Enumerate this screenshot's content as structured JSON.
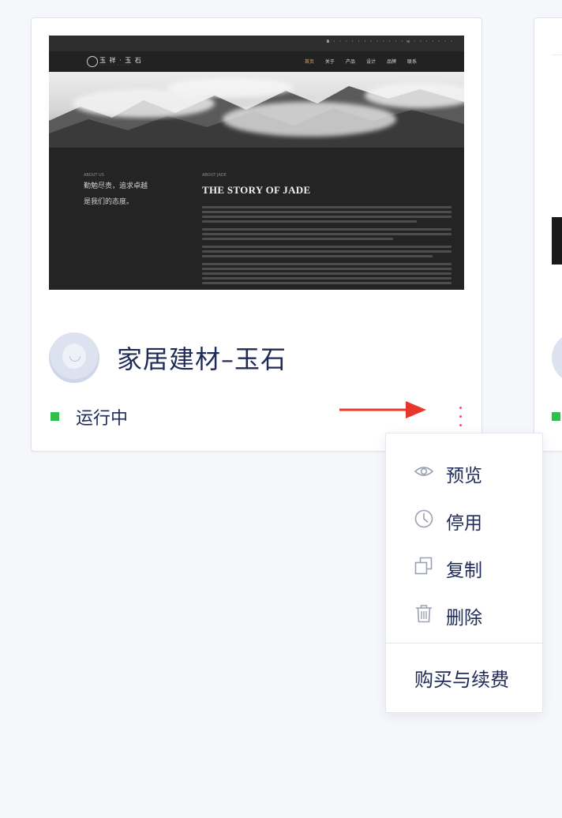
{
  "card": {
    "title": "家居建材–玉石",
    "status": "运行中",
    "status_color": "#2fbf4d",
    "more_color": "#ef4b6b"
  },
  "thumbnail": {
    "logo_text": "玉 祥 · 玉 石",
    "nav_links": [
      "首页",
      "关于",
      "产品",
      "设计",
      "品牌",
      "联系"
    ],
    "intro_label": "ABOUT US",
    "slogan_line1": "勤勉尽责，追求卓越",
    "slogan_line2": "是我们的态度。",
    "story_label": "ABOUT JADE",
    "story_title": "THE STORY OF JADE"
  },
  "menu": {
    "items": [
      {
        "label": "预览",
        "icon": "eye-icon"
      },
      {
        "label": "停用",
        "icon": "clock-icon"
      },
      {
        "label": "复制",
        "icon": "copy-icon"
      },
      {
        "label": "删除",
        "icon": "trash-icon"
      }
    ],
    "buy_label": "购买与续费"
  },
  "annotation": {
    "arrow_color": "#e8362b"
  }
}
